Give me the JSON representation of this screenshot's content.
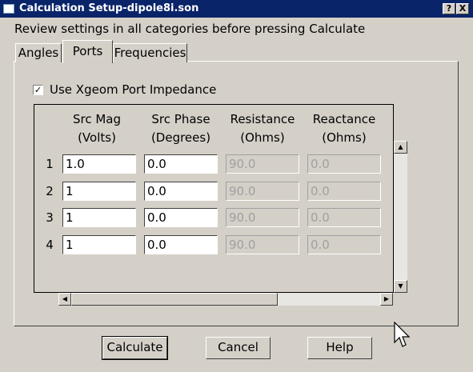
{
  "window": {
    "title": "Calculation Setup-dipole8i.son",
    "help_caption": "?",
    "close_caption": "X"
  },
  "instruction": "Review settings in all categories before pressing Calculate",
  "tabs": [
    {
      "label": "Angles",
      "active": false
    },
    {
      "label": "Ports",
      "active": true
    },
    {
      "label": "Frequencies",
      "active": false
    }
  ],
  "xgeom": {
    "label": "Use Xgeom Port Impedance",
    "checked": true,
    "mark": "✓"
  },
  "grid": {
    "headers": [
      {
        "line1": "Src Mag",
        "line2": "(Volts)"
      },
      {
        "line1": "Src Phase",
        "line2": "(Degrees)"
      },
      {
        "line1": "Resistance",
        "line2": "(Ohms)"
      },
      {
        "line1": "Reactance",
        "line2": "(Ohms)"
      }
    ],
    "rows": [
      {
        "num": "1",
        "src_mag": "1.0",
        "src_phase": "0.0",
        "resistance": "90.0",
        "reactance": "0.0"
      },
      {
        "num": "2",
        "src_mag": "1",
        "src_phase": "0.0",
        "resistance": "90.0",
        "reactance": "0.0"
      },
      {
        "num": "3",
        "src_mag": "1",
        "src_phase": "0.0",
        "resistance": "90.0",
        "reactance": "0.0"
      },
      {
        "num": "4",
        "src_mag": "1",
        "src_phase": "0.0",
        "resistance": "90.0",
        "reactance": "0.0"
      }
    ]
  },
  "scroll": {
    "up": "▲",
    "down": "▼",
    "left": "◀",
    "right": "▶"
  },
  "buttons": {
    "calculate": "Calculate",
    "cancel": "Cancel",
    "help": "Help"
  }
}
